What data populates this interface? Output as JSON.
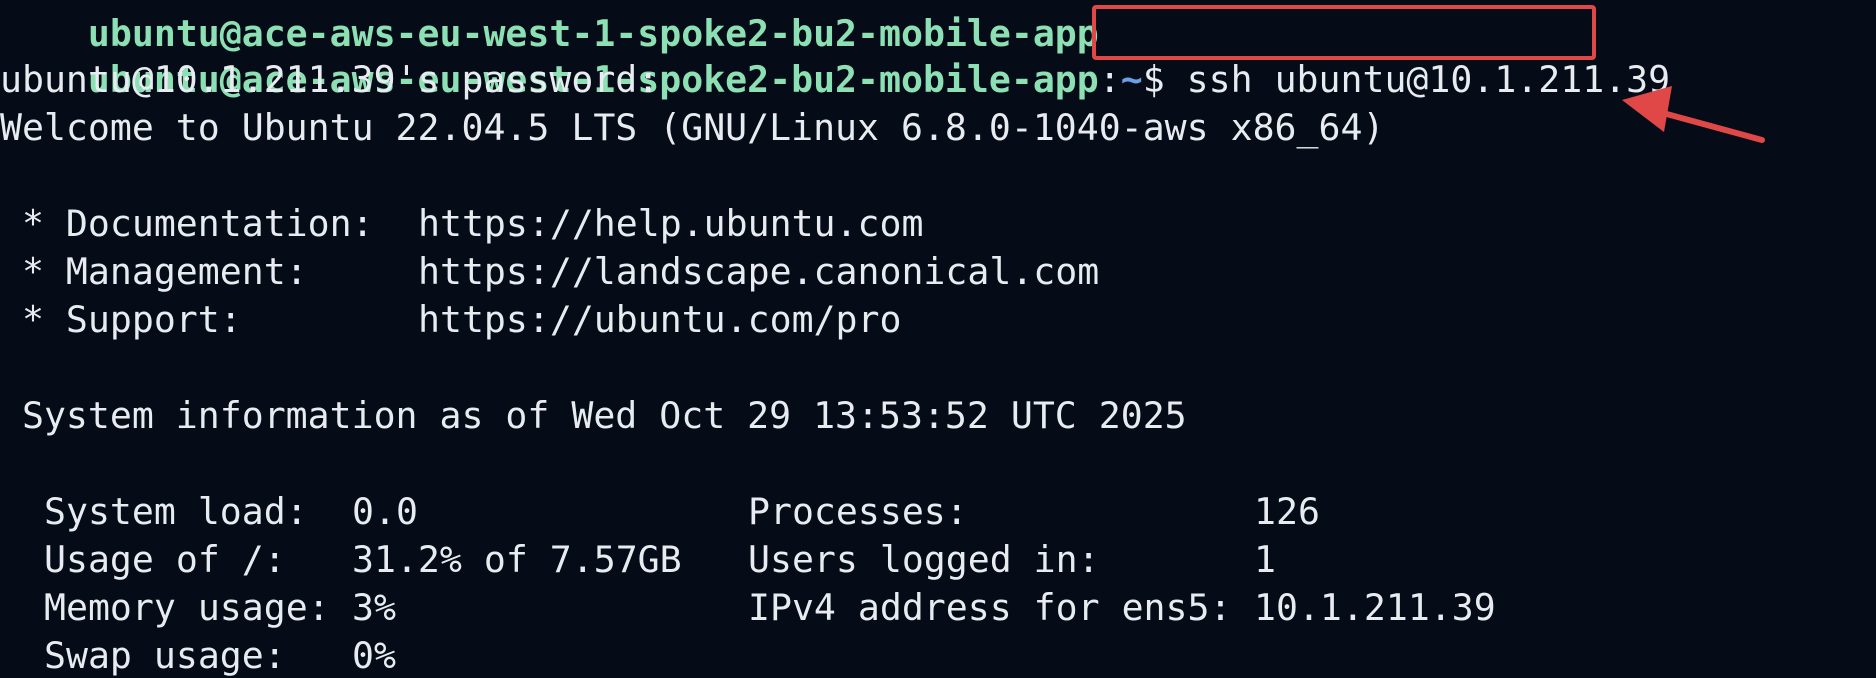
{
  "terminal": {
    "prompt": {
      "user_host": "ubuntu@ace-aws-eu-west-1-spoke2-bu2-mobile-app",
      "colon": ":",
      "path": "~",
      "dollar": "$ "
    },
    "command": "ssh ubuntu@10.1.211.39",
    "password_prompt": "ubuntu@10.1.211.39's password:",
    "welcome": "Welcome to Ubuntu 22.04.5 LTS (GNU/Linux 6.8.0-1040-aws x86_64)",
    "links": [
      {
        "label": " * Documentation:",
        "url": "https://help.ubuntu.com"
      },
      {
        "label": " * Management:",
        "url": "https://landscape.canonical.com"
      },
      {
        "label": " * Support:",
        "url": "https://ubuntu.com/pro"
      }
    ],
    "sysinfo_header": " System information as of Wed Oct 29 13:53:52 UTC 2025",
    "sysinfo": [
      {
        "label": "System load:",
        "value": "0.0",
        "label2": "Processes:",
        "value2": "126"
      },
      {
        "label": "Usage of /:",
        "value": "31.2% of 7.57GB",
        "label2": "Users logged in:",
        "value2": "1"
      },
      {
        "label": "Memory usage:",
        "value": "3%",
        "label2": "IPv4 address for ens5:",
        "value2": "10.1.211.39"
      },
      {
        "label": "Swap usage:",
        "value": "0%",
        "label2": "",
        "value2": ""
      }
    ]
  },
  "annotation": {
    "box_color": "#e04848",
    "arrow_color": "#e04848"
  },
  "colors": {
    "background": "#050c18",
    "text": "#e8ecf0",
    "prompt_user": "#8ce0b4",
    "prompt_path": "#6aa0e8"
  }
}
